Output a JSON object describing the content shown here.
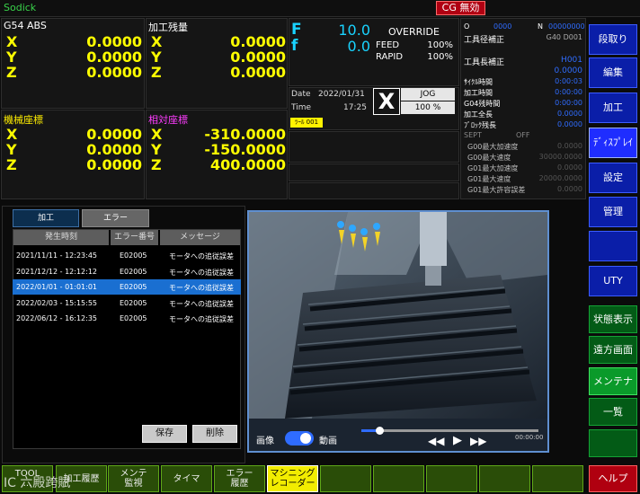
{
  "app": {
    "brand": "Sodick",
    "cg_badge": "CG 無効"
  },
  "coords_abs": {
    "title": "G54 ABS",
    "x": "0.0000",
    "y": "0.0000",
    "z": "0.0000"
  },
  "coords_remain": {
    "title": "加工残量",
    "x": "0.0000",
    "y": "0.0000",
    "z": "0.0000"
  },
  "coords_machine": {
    "title": "機械座標",
    "x": "0.0000",
    "y": "0.0000",
    "z": "0.0000"
  },
  "coords_relative": {
    "title": "相対座標",
    "x": "-310.0000",
    "y": "-150.0000",
    "z": "400.0000"
  },
  "axis_labels": {
    "x": "X",
    "y": "Y",
    "z": "Z"
  },
  "feed": {
    "f_label": "F",
    "f_value": "10.0",
    "fs_label": "f",
    "fs_value": "0.0",
    "override_label": "OVERRIDE",
    "feed_label": "FEED",
    "feed_pct": "100%",
    "rapid_label": "RAPID",
    "rapid_pct": "100%"
  },
  "datetime": {
    "date_label": "Date",
    "date": "2022/01/31",
    "time_label": "Time",
    "time": "17:25"
  },
  "jog": {
    "axis": "X",
    "mode": "JOG",
    "pct": "100 %"
  },
  "tool_tag": "ﾂｰﾙ 001",
  "info": {
    "o_label": "O",
    "o_value": "0000",
    "n_label": "N",
    "n_value": "00000000",
    "tool_dia_label": "工具径補正",
    "tool_dia_value": "G40 D001",
    "tool_len_label": "工具長補正",
    "tool_len_value": "H001",
    "tool_len_amount": "0.0000",
    "rows": [
      {
        "label": "ｻｲｸﾙ時間",
        "value": "0:00:03"
      },
      {
        "label": "加工時間",
        "value": "0:00:00"
      },
      {
        "label": "G04残時間",
        "value": "0:00:00"
      },
      {
        "label": "加工全長",
        "value": "0.0000"
      },
      {
        "label": "ﾌﾞﾛｯｸ残長",
        "value": "0.0000"
      }
    ],
    "sept_label": "SEPT",
    "sept_value": "OFF",
    "g_rows": [
      {
        "label": "G00最大加速度",
        "value": "0.0000"
      },
      {
        "label": "G00最大速度",
        "value": "30000.0000"
      },
      {
        "label": "G01最大加速度",
        "value": "0.0000"
      },
      {
        "label": "G01最大速度",
        "value": "20000.0000"
      },
      {
        "label": "G01最大許容誤差",
        "value": "0.0000"
      }
    ]
  },
  "side_buttons": [
    "段取り",
    "編集",
    "加工",
    "ﾃﾞｨｽﾌﾟﾚｲ",
    "設定",
    "管理",
    "",
    "UTY"
  ],
  "green_buttons": [
    "状態表示",
    "遠方画面",
    "メンテナンス",
    "一覧",
    ""
  ],
  "help_button": "ヘルプ",
  "tabs": {
    "machining": "加工",
    "error": "エラー"
  },
  "error_table": {
    "headers": [
      "発生時刻",
      "エラー番号",
      "メッセージ"
    ],
    "rows": [
      {
        "time": "2021/11/11 - 12:23:45",
        "code": "E02005",
        "msg": "モータへの追従誤差"
      },
      {
        "time": "2021/12/12 - 12:12:12",
        "code": "E02005",
        "msg": "モータへの追従誤差"
      },
      {
        "time": "2022/01/01 - 01:01:01",
        "code": "E02005",
        "msg": "モータへの追従誤差"
      },
      {
        "time": "2022/02/03 - 15:15:55",
        "code": "E02005",
        "msg": "モータへの追従誤差"
      },
      {
        "time": "2022/06/12 - 16:12:35",
        "code": "E02005",
        "msg": "モータへの追従誤差"
      }
    ],
    "selected_index": 2,
    "save_label": "保存",
    "delete_label": "削除"
  },
  "media": {
    "image_label": "画像",
    "video_label": "動画",
    "time": "00:00:00",
    "progress": 0.1
  },
  "soft_keys": [
    "TOOL\n...",
    "加工履歴",
    "メンテ\n監視",
    "タイマ",
    "エラー\n履歴",
    "マシニング\nレコーダー",
    "",
    "",
    "",
    "",
    ""
  ],
  "watermark": "IC 六殿跨賦"
}
